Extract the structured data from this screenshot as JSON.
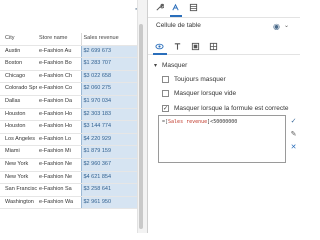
{
  "sheet": {
    "headers": [
      "City",
      "Store name",
      "Sales revenue"
    ],
    "rows": [
      [
        "Austin",
        "e-Fashion Au",
        "$2 699 673"
      ],
      [
        "Boston",
        "e-Fashion Bo",
        "$1 283 707"
      ],
      [
        "Chicago",
        "e-Fashion Ch",
        "$3 022 658"
      ],
      [
        "Colorado Springs",
        "e-Fashion Co",
        "$2 060 275"
      ],
      [
        "Dallas",
        "e-Fashion Da",
        "$1 970 034"
      ],
      [
        "Houston",
        "e-Fashion Ho",
        "$2 303 183"
      ],
      [
        "Houston",
        "e-Fashion Ho",
        "$3 144 774"
      ],
      [
        "Los Angeles",
        "e-Fashion Lo",
        "$4 220 929"
      ],
      [
        "Miami",
        "e-Fashion Mi",
        "$1 879 159"
      ],
      [
        "New York",
        "e-Fashion Ne",
        "$2 960 367"
      ],
      [
        "New York",
        "e-Fashion Ne",
        "$4 621 854"
      ],
      [
        "San Francisco",
        "e-Fashion Sa",
        "$3 258 641"
      ],
      [
        "Washington",
        "e-Fashion Wa",
        "$2 961 950"
      ]
    ]
  },
  "toolbar": {
    "add_icon": "plus-icon",
    "icons": [
      "wrench-icon",
      "format-icon",
      "data-icon"
    ]
  },
  "panel": {
    "title": "Cellule de table",
    "tabs": [
      "eye-icon",
      "text-icon",
      "layout-icon",
      "grid-icon"
    ],
    "section_title": "Masquer",
    "options": [
      {
        "label": "Toujours masquer",
        "checked": false
      },
      {
        "label": "Masquer lorsque vide",
        "checked": false
      },
      {
        "label": "Masquer lorsque la formule est correcte",
        "checked": true
      }
    ],
    "formula": {
      "open": "=[",
      "field": "Sales revenue",
      "close": "]<50000000"
    }
  },
  "colors": {
    "accent": "#2a6ebb",
    "selected_cell": "#d6e4f2",
    "formula_field": "#c0392b"
  }
}
